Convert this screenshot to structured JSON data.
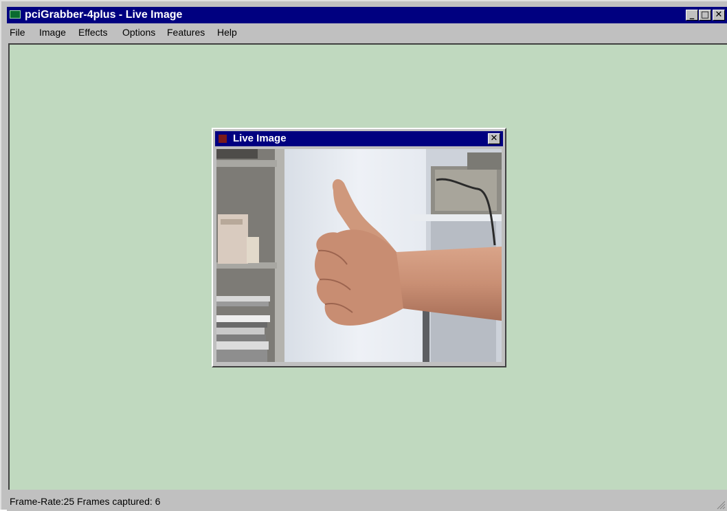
{
  "window": {
    "title": "pciGrabber-4plus - Live Image",
    "controls": {
      "minimize": "_",
      "maximize": "□",
      "close": "✕"
    }
  },
  "menu": [
    {
      "label": "File"
    },
    {
      "label": "Image"
    },
    {
      "label": "Effects"
    },
    {
      "label": "Options"
    },
    {
      "label": "Features"
    },
    {
      "label": "Help"
    }
  ],
  "child_window": {
    "title": "Live Image",
    "close": "✕",
    "icon": "grabber-icon"
  },
  "status": {
    "text": "Frame-Rate:25  Frames captured: 6"
  },
  "colors": {
    "titlebar": "#000080",
    "workspace": "#c0d9bf",
    "chrome": "#c0c0c0"
  }
}
